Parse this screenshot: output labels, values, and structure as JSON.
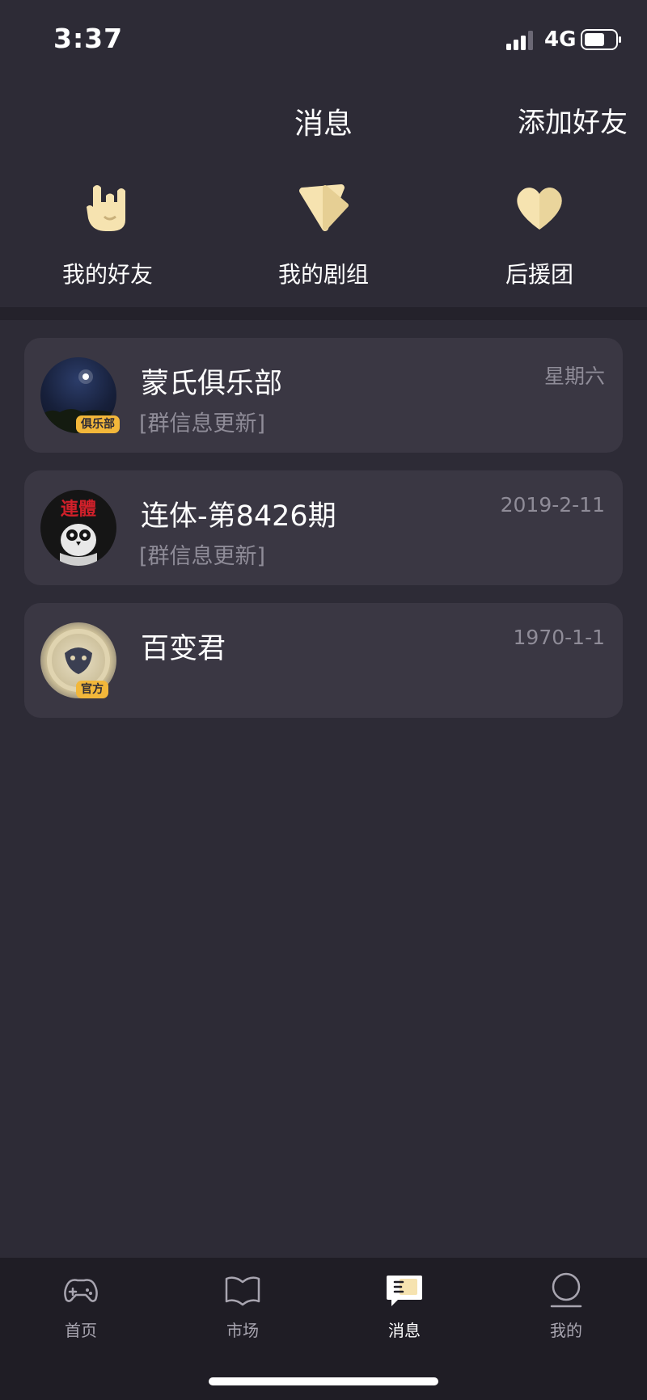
{
  "status": {
    "time": "3:37",
    "network": "4G"
  },
  "header": {
    "title": "消息",
    "add_friend": "添加好友"
  },
  "shortcuts": [
    {
      "label": "我的好友",
      "icon": "rock-hand-icon"
    },
    {
      "label": "我的剧组",
      "icon": "play-triangle-icon"
    },
    {
      "label": "后援团",
      "icon": "heart-icon"
    }
  ],
  "chats": [
    {
      "name": "蒙氏俱乐部",
      "preview": "[群信息更新]",
      "time": "星期六",
      "badge": "俱乐部"
    },
    {
      "name": "连体-第8426期",
      "preview": "[群信息更新]",
      "time": "2019-2-11",
      "avatar_text": "連體"
    },
    {
      "name": "百变君",
      "preview": "",
      "time": "1970-1-1",
      "badge": "官方"
    }
  ],
  "tabs": [
    {
      "label": "首页",
      "icon": "gamepad-icon",
      "active": false
    },
    {
      "label": "市场",
      "icon": "book-icon",
      "active": false
    },
    {
      "label": "消息",
      "icon": "message-icon",
      "active": true
    },
    {
      "label": "我的",
      "icon": "profile-icon",
      "active": false
    }
  ],
  "colors": {
    "background": "#2d2b36",
    "card": "#3a3743",
    "accent": "#f6e3b0",
    "badge": "#f2b73a"
  }
}
